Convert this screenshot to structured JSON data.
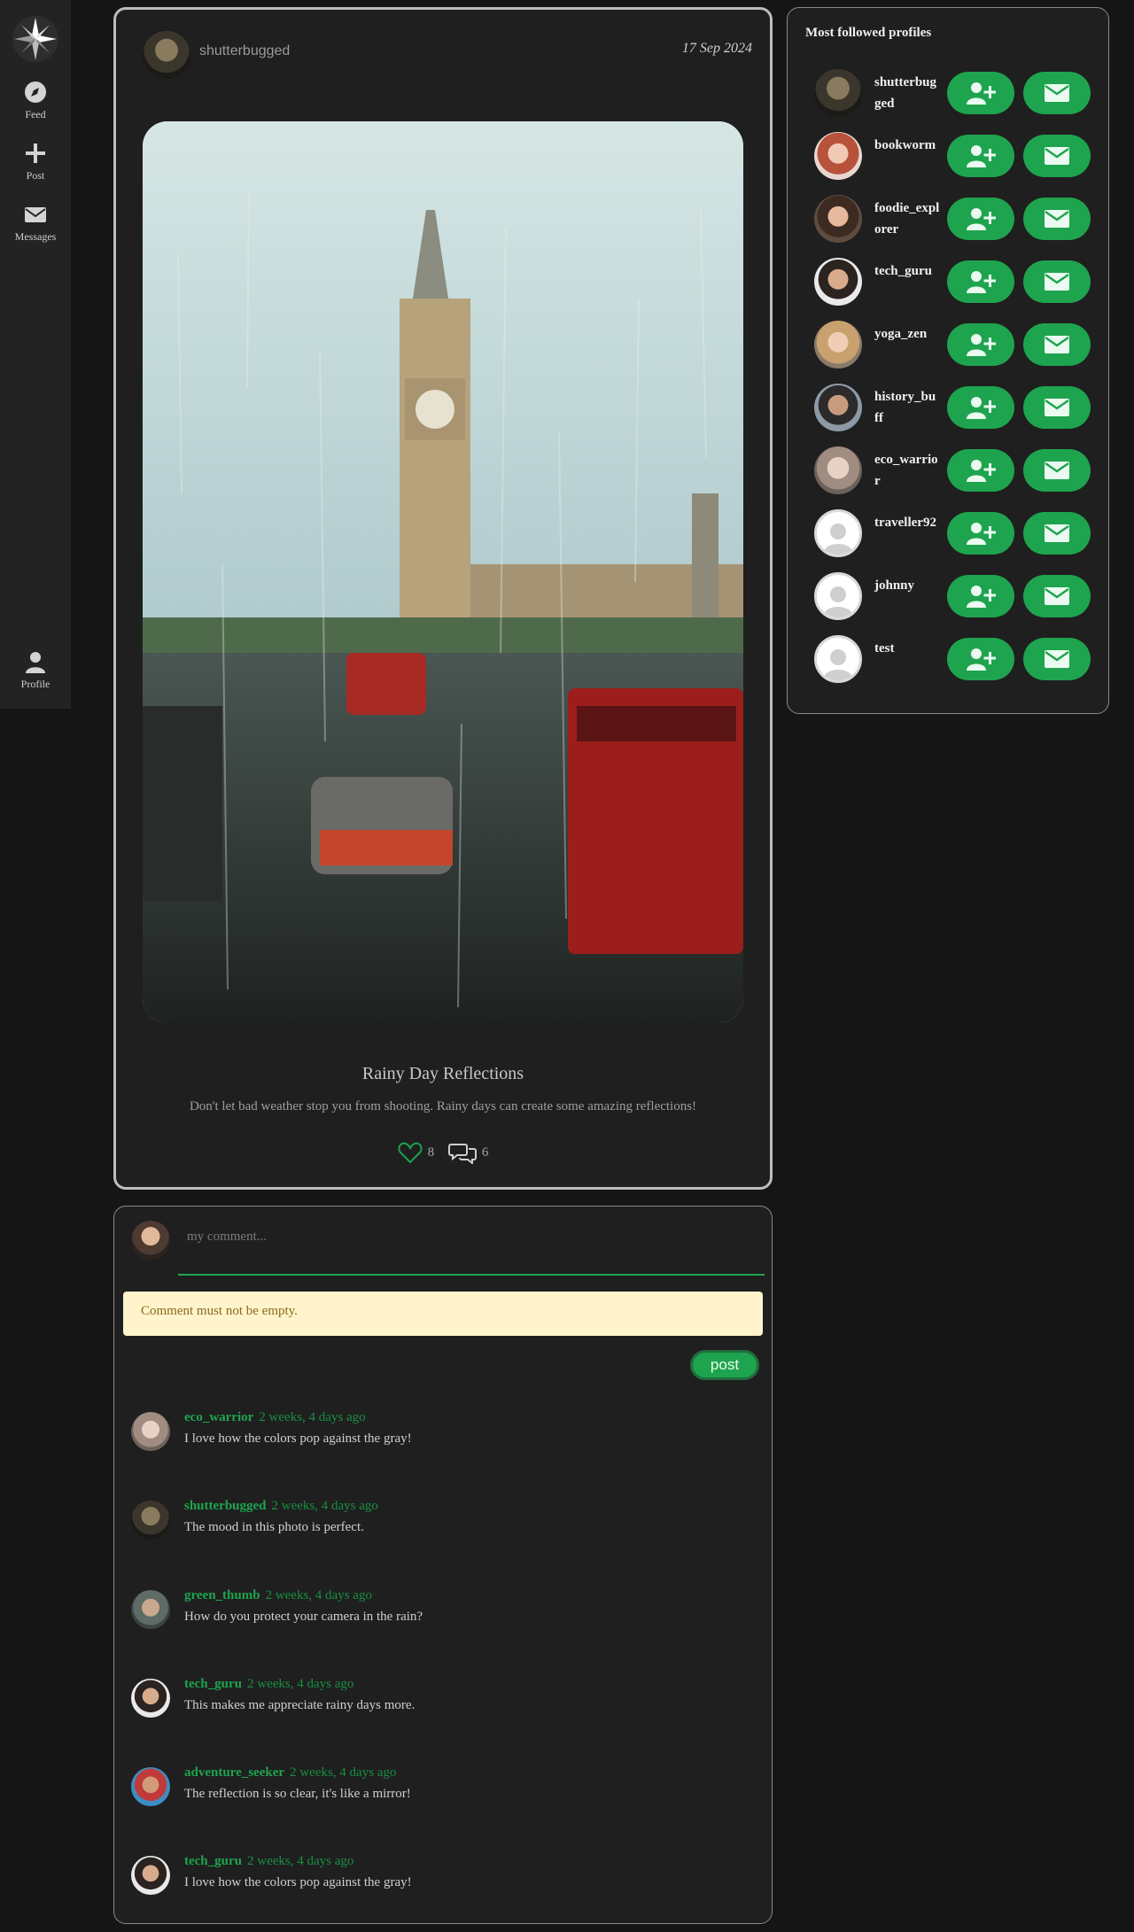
{
  "sidebar": {
    "logo_icon": "compass-star-icon",
    "items": [
      {
        "label": "Feed",
        "icon": "compass-icon"
      },
      {
        "label": "Post",
        "icon": "plus-icon"
      },
      {
        "label": "Messages",
        "icon": "envelope-icon"
      },
      {
        "label": "Profile",
        "icon": "user-icon"
      }
    ]
  },
  "post": {
    "username": "shutterbugged",
    "date": "17 Sep 2024",
    "title": "Rainy Day Reflections",
    "description": "Don't let bad weather stop you from shooting. Rainy days can create some amazing reflections!",
    "likes": "8",
    "comments_count": "6"
  },
  "comment_form": {
    "placeholder": "my comment...",
    "error": "Comment must not be empty.",
    "submit_label": "post"
  },
  "comments": [
    {
      "user": "eco_warrior",
      "time": "2 weeks, 4 days ago",
      "text": "I love how the colors pop against the gray!"
    },
    {
      "user": "shutterbugged",
      "time": "2 weeks, 4 days ago",
      "text": "The mood in this photo is perfect."
    },
    {
      "user": "green_thumb",
      "time": "2 weeks, 4 days ago",
      "text": "How do you protect your camera in the rain?"
    },
    {
      "user": "tech_guru",
      "time": "2 weeks, 4 days ago",
      "text": "This makes me appreciate rainy days more."
    },
    {
      "user": "adventure_seeker",
      "time": "2 weeks, 4 days ago",
      "text": "The reflection is so clear, it's like a mirror!"
    },
    {
      "user": "tech_guru",
      "time": "2 weeks, 4 days ago",
      "text": "I love how the colors pop against the gray!"
    }
  ],
  "profiles": {
    "title": "Most followed profiles",
    "items": [
      {
        "name": "shutterbugged"
      },
      {
        "name": "bookworm"
      },
      {
        "name": "foodie_explorer"
      },
      {
        "name": "tech_guru"
      },
      {
        "name": "yoga_zen"
      },
      {
        "name": "history_buff"
      },
      {
        "name": "eco_warrior"
      },
      {
        "name": "traveller92"
      },
      {
        "name": "johnny"
      },
      {
        "name": "test"
      }
    ]
  },
  "colors": {
    "accent": "#1ea44e",
    "background": "#151515",
    "card": "#1f1f1f",
    "alert_bg": "#fff4cc"
  }
}
